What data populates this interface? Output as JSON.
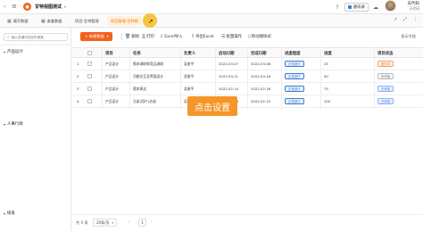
{
  "titlebar": {
    "app_title": "甘特视图测试",
    "notify_label": "通讯录",
    "user_name": "天代码",
    "user_org": "天代码"
  },
  "tabs": [
    {
      "icon": "table-icon",
      "label": "填写数据"
    },
    {
      "icon": "table-icon",
      "label": "查看数据"
    },
    {
      "icon": "",
      "label": "项目-甘特管理"
    },
    {
      "icon": "",
      "label": "项目管理-甘特视"
    }
  ],
  "sidebar": {
    "search_placeholder": "输入关键词并回车搜索",
    "groups": [
      "产品设计",
      "人事行政",
      "研发"
    ]
  },
  "toolbar": {
    "new_label": "+ 新建数据",
    "tools": [
      "删除",
      "打印",
      "Excel导入",
      "导出Excel",
      "批量操作",
      "移动端样式"
    ],
    "show_fields": "显示字段"
  },
  "table": {
    "headers": [
      "项目",
      "任务",
      "负责人",
      "启动日期",
      "完成日期",
      "进度程度",
      "进度",
      "项目状态"
    ],
    "rows": [
      {
        "no": "1",
        "project": "产品设计",
        "task": "需求调研和竞品调研",
        "owner": "吴俊平",
        "start": "2022-03-07",
        "end": "2022-03-08",
        "progress": "正常进行",
        "pct": "25",
        "status": "进行中"
      },
      {
        "no": "2",
        "project": "产品设计",
        "task": "功能交互及界面设计",
        "owner": "吴俊平",
        "start": "2022-03-11",
        "end": "2022-03-16",
        "progress": "正常进行",
        "pct": "50",
        "status": "未开始"
      },
      {
        "no": "3",
        "project": "产品设计",
        "task": "需求表达",
        "owner": "吴俊平",
        "start": "2022-02-14",
        "end": "2022-02-16",
        "progress": "正常进行",
        "pct": "75",
        "status": "已完成"
      },
      {
        "no": "4",
        "project": "产品设计",
        "task": "兄弟(用户)访谈",
        "owner": "吴俊平",
        "start": "2022-02-08",
        "end": "2022-02-10",
        "progress": "正常进行",
        "pct": "100",
        "status": "已完成"
      }
    ]
  },
  "overlay": {
    "label": "点击设置"
  },
  "footer": {
    "total": "共 4 条",
    "page_size": "20条/页",
    "page_num": "1"
  },
  "colors": {
    "accent": "#f2611d",
    "tab_active_bg": "#fff1de",
    "overlay_bg": "#f5962a",
    "progress_blue": "#3a7bd5"
  }
}
